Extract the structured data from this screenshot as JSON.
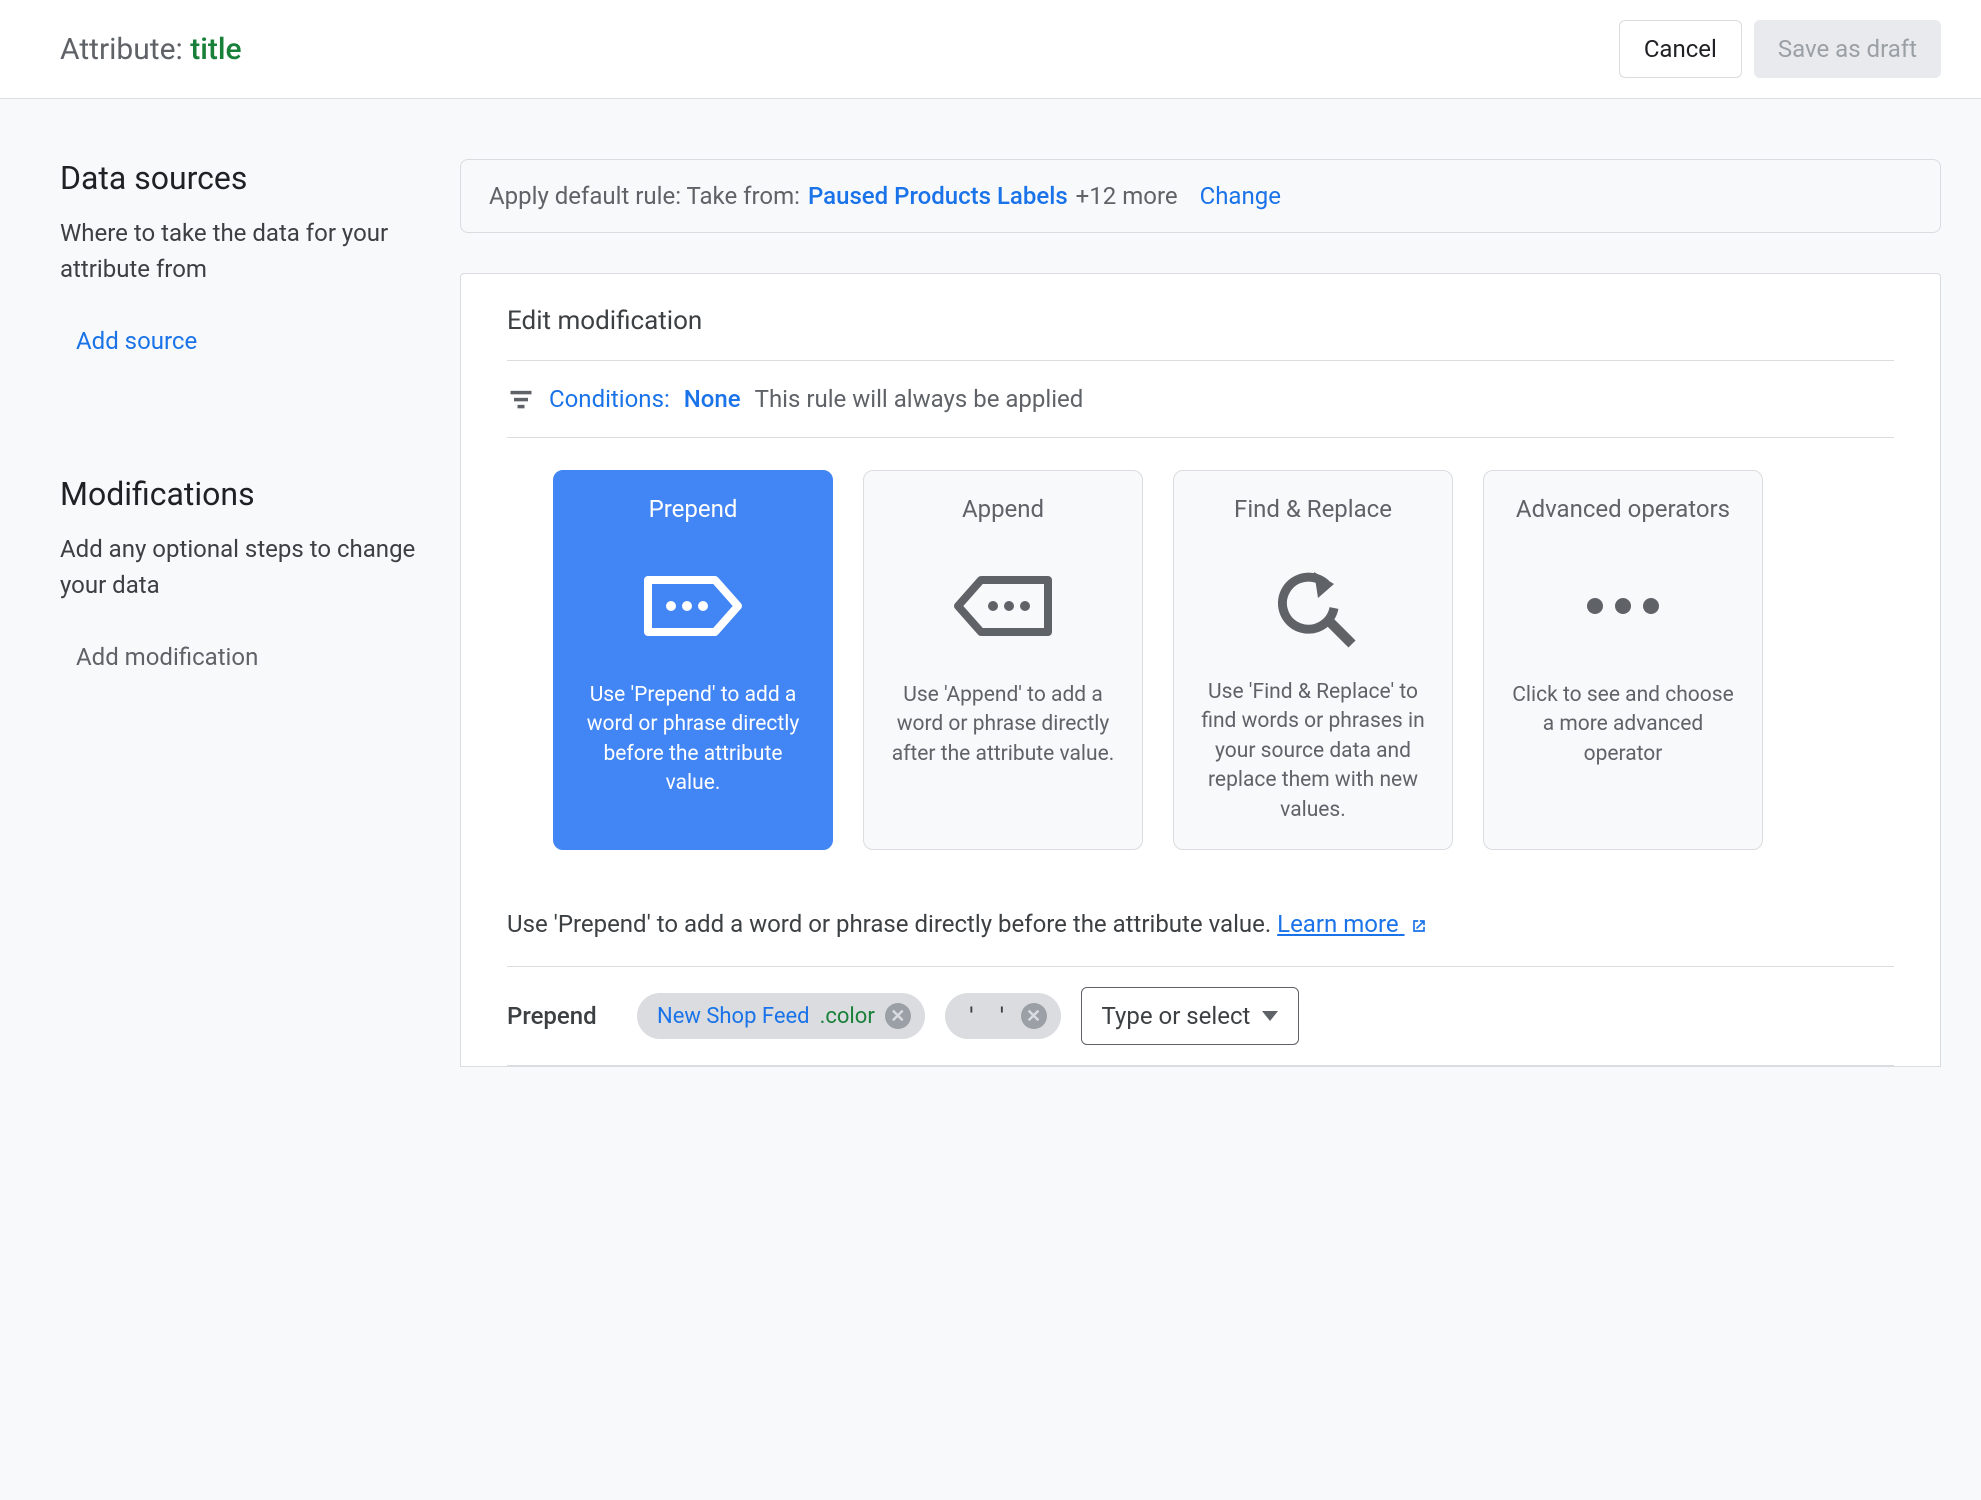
{
  "header": {
    "attribute_prefix": "Attribute: ",
    "attribute_name": "title",
    "cancel_label": "Cancel",
    "save_label": "Save as draft"
  },
  "data_sources": {
    "heading": "Data sources",
    "description": "Where to take the data for your attribute from",
    "add_source_label": "Add source",
    "default_rule": {
      "prefix": "Apply default rule: Take from: ",
      "feed_name": "Paused Products Labels",
      "more_text": " +12 more",
      "change_label": "Change"
    }
  },
  "modifications": {
    "heading": "Modifications",
    "description": "Add any optional steps to change your data",
    "add_modification_label": "Add modification",
    "card_title": "Edit modification",
    "conditions": {
      "label": "Conditions: ",
      "value": "None",
      "description": "This rule will always be applied"
    },
    "operators": [
      {
        "title": "Prepend",
        "description": "Use 'Prepend' to add a word or phrase directly before the attribute value.",
        "selected": true,
        "icon": "prepend"
      },
      {
        "title": "Append",
        "description": "Use 'Append' to add a word or phrase directly after the attribute value.",
        "selected": false,
        "icon": "append"
      },
      {
        "title": "Find & Replace",
        "description": "Use 'Find & Replace' to find words or phrases in your source data and replace them with new values.",
        "selected": false,
        "icon": "find-replace"
      },
      {
        "title": "Advanced operators",
        "description": "Click to see and choose a more advanced operator",
        "selected": false,
        "icon": "dots"
      }
    ],
    "help_text": "Use 'Prepend' to add a word or phrase directly before the attribute value. ",
    "learn_more_label": "Learn more",
    "prepend_row": {
      "label": "Prepend",
      "chips": [
        {
          "type": "ref",
          "feed": "New Shop Feed",
          "attr": ".color"
        },
        {
          "type": "literal",
          "text": "' '"
        }
      ],
      "type_select_label": "Type or select"
    }
  }
}
